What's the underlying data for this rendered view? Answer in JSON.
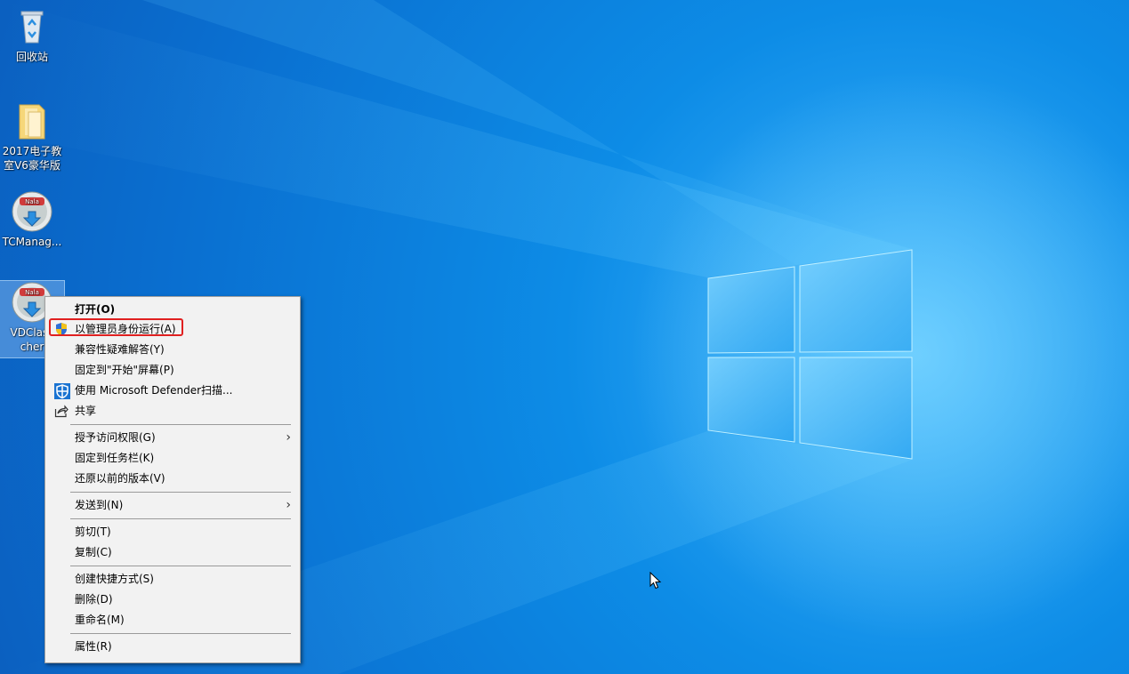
{
  "desktop": {
    "icons": [
      {
        "label": "回收站"
      },
      {
        "label": "2017电子教\n室V6豪华版"
      },
      {
        "label": "TCManag..."
      },
      {
        "label": "VDClass\ncher"
      }
    ]
  },
  "context_menu": {
    "items": [
      {
        "label": "打开(O)",
        "bold": true
      },
      {
        "label": "以管理员身份运行(A)",
        "icon": "uac-shield-icon",
        "highlighted": true
      },
      {
        "label": "兼容性疑难解答(Y)"
      },
      {
        "label": "固定到\"开始\"屏幕(P)"
      },
      {
        "label": "使用 Microsoft Defender扫描...",
        "icon": "defender-shield-icon"
      },
      {
        "label": "共享",
        "icon": "share-icon"
      },
      {
        "label": "授予访问权限(G)",
        "submenu": true
      },
      {
        "label": "固定到任务栏(K)"
      },
      {
        "label": "还原以前的版本(V)"
      },
      {
        "label": "发送到(N)",
        "submenu": true
      },
      {
        "label": "剪切(T)"
      },
      {
        "label": "复制(C)"
      },
      {
        "label": "创建快捷方式(S)"
      },
      {
        "label": "删除(D)"
      },
      {
        "label": "重命名(M)"
      },
      {
        "label": "属性(R)"
      }
    ],
    "submenu_arrow": "›"
  },
  "colors": {
    "highlight_border": "#e02020",
    "menu_bg": "#f2f2f2",
    "desktop_blue": "#0a78d8"
  }
}
